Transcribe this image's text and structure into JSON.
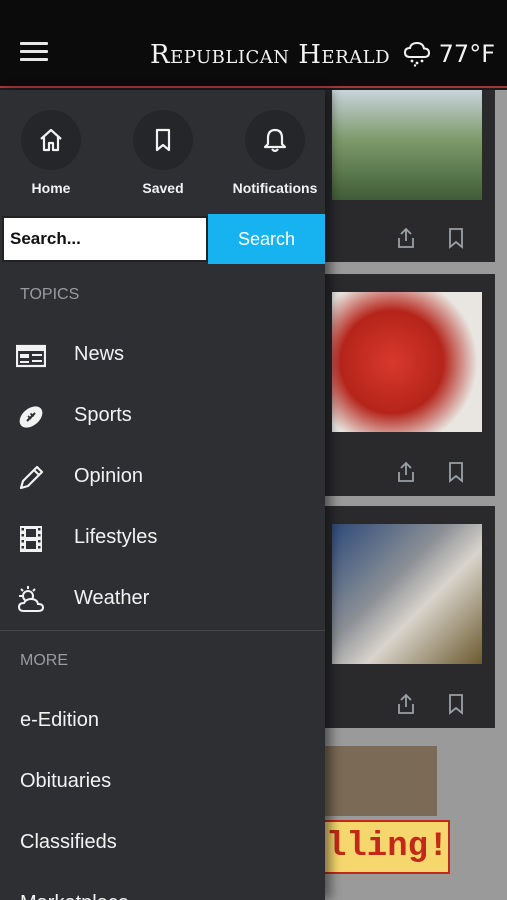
{
  "header": {
    "brand": "Republican Herald",
    "temperature": "77°F",
    "weather_icon": "cloud-snow-icon"
  },
  "drawer": {
    "quick_actions": [
      {
        "label": "Home",
        "icon": "home-icon"
      },
      {
        "label": "Saved",
        "icon": "bookmark-icon"
      },
      {
        "label": "Notifications",
        "icon": "bell-icon"
      }
    ],
    "search": {
      "value": "Search...",
      "button_label": "Search"
    },
    "topics": {
      "title": "TOPICS",
      "items": [
        {
          "label": "News",
          "icon": "newspaper-icon"
        },
        {
          "label": "Sports",
          "icon": "football-icon"
        },
        {
          "label": "Opinion",
          "icon": "pencil-icon"
        },
        {
          "label": "Lifestyles",
          "icon": "film-icon"
        },
        {
          "label": "Weather",
          "icon": "sun-cloud-icon"
        }
      ]
    },
    "more": {
      "title": "MORE",
      "items": [
        {
          "label": "e-Edition"
        },
        {
          "label": "Obituaries"
        },
        {
          "label": "Classifieds"
        },
        {
          "label": "Marketplace"
        }
      ]
    }
  },
  "background": {
    "ad_text": "lling!"
  },
  "colors": {
    "accent": "#17b3f0",
    "drawer_bg": "#2e2f33",
    "header_bg": "#0b0b0b",
    "header_rule": "#a33a2e"
  }
}
